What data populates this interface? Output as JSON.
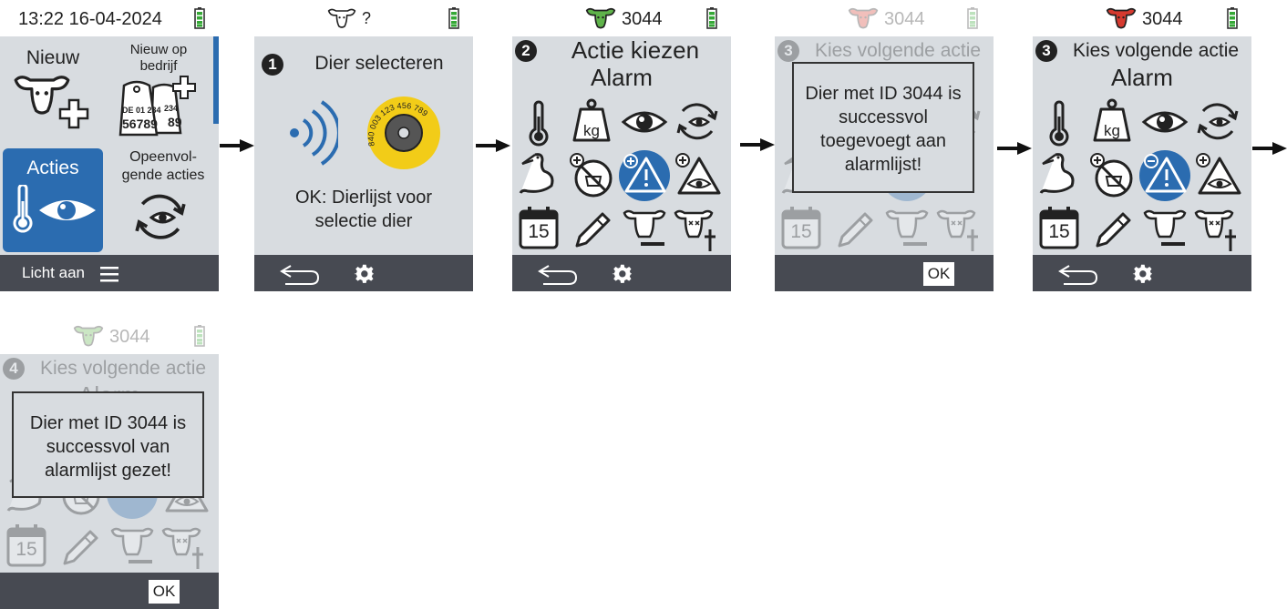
{
  "screen1": {
    "datetime": "13:22 16-04-2024",
    "tile_new_label": "Nieuw",
    "tile_new_farm_label": "Nieuw op bedrijf",
    "tag_line1": "DE 01 234",
    "tag_line2": "56789",
    "tag_back_line1": "234",
    "tag_back_line2": "89",
    "tile_actions_label": "Acties",
    "tile_sequential_label": "Opeenvol-gende acties",
    "light_label": "Licht aan"
  },
  "screen2": {
    "animal_id": "?",
    "step": "1",
    "title": "Dier selecteren",
    "tag_number": "840 003 123 456 789",
    "hint": "OK: Dierlijst voor selectie dier"
  },
  "screen3": {
    "animal_id": "3044",
    "step": "2",
    "title": "Actie kiezen",
    "subtitle": "Alarm",
    "calendar_day": "15",
    "kg_label": "kg"
  },
  "screen4": {
    "animal_id": "3044",
    "step": "3",
    "title": "Kies volgende actie",
    "dialog": "Dier met ID 3044 is successvol toegevoegt aan alarmlijst!",
    "ok_label": "OK",
    "calendar_day": "15"
  },
  "screen5": {
    "animal_id": "3044",
    "step": "3",
    "title": "Kies volgende actie",
    "subtitle": "Alarm",
    "calendar_day": "15",
    "kg_label": "kg"
  },
  "screen6": {
    "animal_id": "3044",
    "step": "4",
    "title": "Kies volgende actie",
    "subtitle": "Alarm",
    "dialog": "Dier met ID 3044 is successvol van alarmlijst gezet!",
    "ok_label": "OK",
    "calendar_day": "15"
  },
  "colors": {
    "screen_bg": "#d8dce0",
    "bottom_bar": "#474a52",
    "accent_blue": "#2b6cb0",
    "cow_green": "#5fb34a",
    "cow_red": "#d63a2f",
    "battery_green": "#35a836",
    "tag_yellow": "#f2cc18"
  }
}
